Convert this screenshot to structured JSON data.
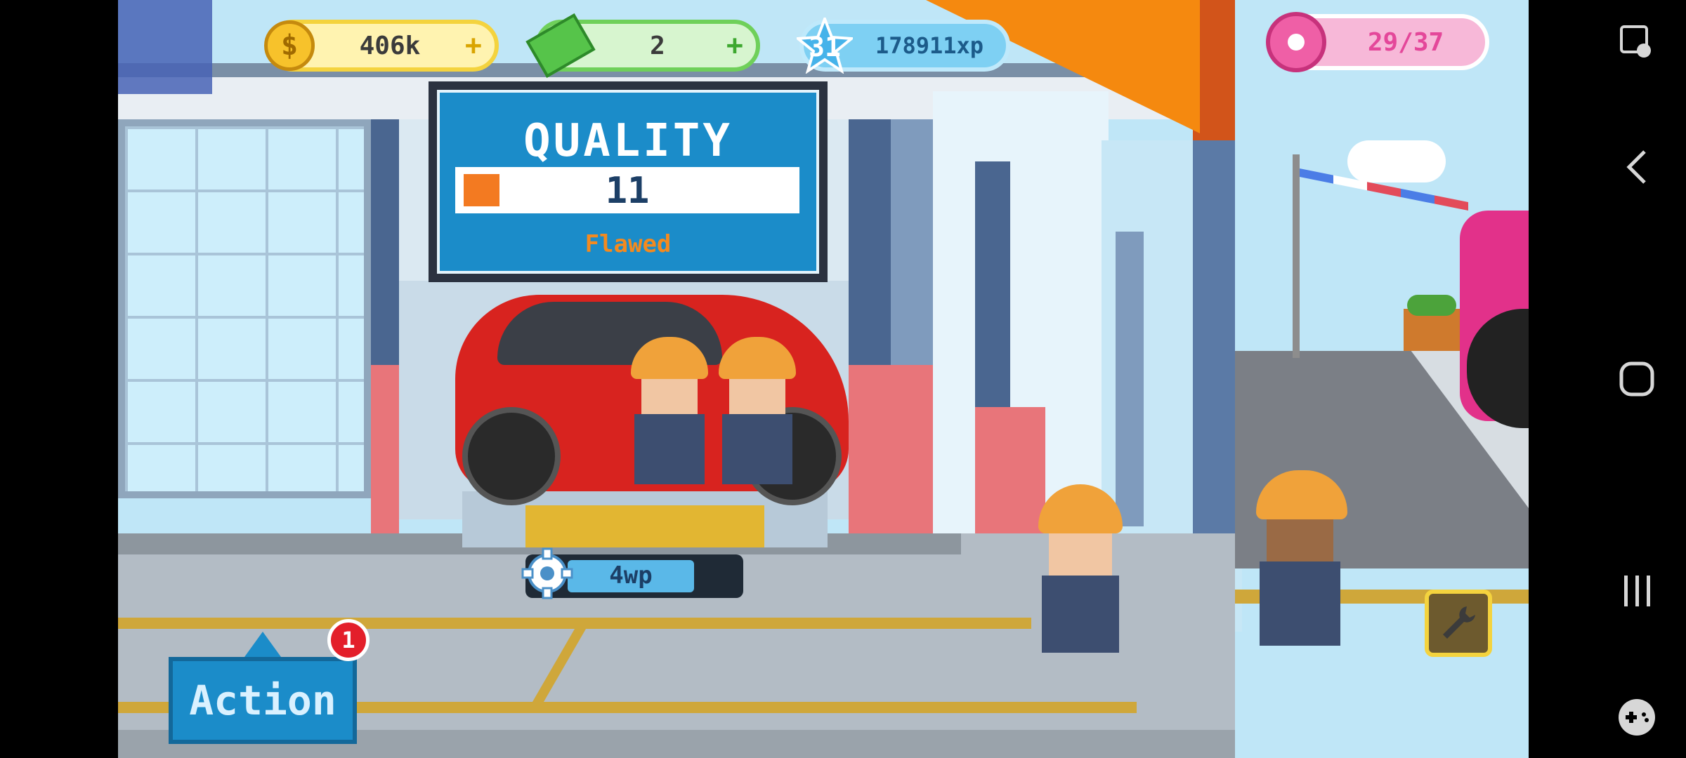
{
  "hud": {
    "coins": "406k",
    "coin_plus": "+",
    "cash": "2",
    "cash_plus": "+",
    "level": "31",
    "xp": "178911xp",
    "donuts": "29/37"
  },
  "quality_panel": {
    "title": "QUALITY",
    "value": "11",
    "rating": "Flawed",
    "fill_fraction": 0.11
  },
  "work_bar": {
    "label": "4wp",
    "fill_fraction": 0.75
  },
  "action_button": {
    "label": "Action",
    "badge_count": "1"
  },
  "colors": {
    "accent_blue": "#1b8cc9",
    "coin_yellow": "#f7c22b",
    "cash_green": "#56c44a",
    "donut_pink": "#ef5fa6",
    "rating_orange": "#f38a1f"
  },
  "icons": {
    "avatar": "player-avatar",
    "coin": "dollar-coin-icon",
    "cash": "banknote-icon",
    "level": "star-level-icon",
    "donut": "donut-icon",
    "gear": "gear-icon",
    "wrench": "wrench-icon",
    "nav": [
      "screen-record-icon",
      "back-icon",
      "home-icon",
      "recents-icon",
      "gamepad-icon"
    ]
  }
}
